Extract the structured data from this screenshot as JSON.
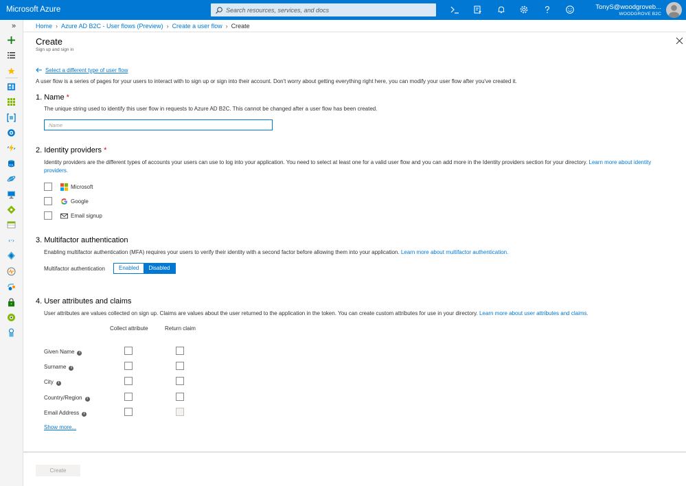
{
  "header": {
    "brand": "Microsoft Azure",
    "search_placeholder": "Search resources, services, and docs",
    "user": "TonyS@woodgroveb...",
    "tenant": "WOODGROVE B2C",
    "icons": [
      "cloud-shell-icon",
      "directory-filter-icon",
      "notifications-icon",
      "settings-icon",
      "help-icon",
      "feedback-icon"
    ]
  },
  "sidebar": {
    "collapse_label": "»",
    "icons": [
      "create-resource-icon",
      "all-services-icon",
      "favorites-icon",
      "dashboard-icon",
      "all-resources-icon",
      "resource-groups-icon",
      "app-services-icon",
      "function-apps-icon",
      "sql-databases-icon",
      "cosmos-db-icon",
      "virtual-machines-icon",
      "load-balancers-icon",
      "storage-accounts-icon",
      "virtual-networks-icon",
      "azure-ad-icon",
      "monitor-icon",
      "advisor-icon",
      "security-center-icon",
      "cost-management-icon",
      "help-support-icon"
    ]
  },
  "breadcrumb": {
    "items": [
      "Home",
      "Azure AD B2C - User flows (Preview)",
      "Create a user flow"
    ],
    "current": "Create"
  },
  "panel": {
    "title": "Create",
    "subtitle": "Sign up and sign in",
    "back_link": "Select a different type of user flow",
    "intro": "A user flow is a series of pages for your users to interact with to sign up or sign into their account. Don't worry about getting everything right here, you can modify your user flow after you've created it."
  },
  "name_section": {
    "heading": "1. Name",
    "required_mark": "*",
    "description": "The unique string used to identify this user flow in requests to Azure AD B2C. This cannot be changed after a user flow has been created.",
    "placeholder": "Name",
    "value": ""
  },
  "idp_section": {
    "heading": "2. Identity providers",
    "required_mark": "*",
    "description": "Identity providers are the different types of accounts your users can use to log into your application. You need to select at least one for a valid user flow and you can add more in the Identity providers section for your directory. ",
    "link": "Learn more about identity providers.",
    "providers": [
      {
        "label": "Microsoft",
        "icon": "microsoft-logo-icon",
        "checked": false
      },
      {
        "label": "Google",
        "icon": "google-logo-icon",
        "checked": false
      },
      {
        "label": "Email signup",
        "icon": "email-icon",
        "checked": false
      }
    ]
  },
  "mfa_section": {
    "heading": "3. Multifactor authentication",
    "description": "Enabling multifactor authentication (MFA) requires your users to verify their identity with a second factor before allowing them into your application. ",
    "link": "Learn more about multifactor authentication.",
    "label": "Multifactor authentication",
    "options": [
      "Enabled",
      "Disabled"
    ],
    "selected": "Disabled"
  },
  "attributes_section": {
    "heading": "4. User attributes and claims",
    "description": "User attributes are values collected on sign up. Claims are values about the user returned to the application in the token. You can create custom attributes for use in your directory. ",
    "link": "Learn more about user attributes and claims.",
    "col_collect": "Collect attribute",
    "col_return": "Return claim",
    "rows": [
      {
        "label": "Given Name",
        "collect": false,
        "return": false
      },
      {
        "label": "Surname",
        "collect": false,
        "return": false
      },
      {
        "label": "City",
        "collect": false,
        "return": false
      },
      {
        "label": "Country/Region",
        "collect": false,
        "return": false
      },
      {
        "label": "Email Address",
        "collect": false,
        "return": false,
        "return_disabled": true
      }
    ],
    "show_more": "Show more..."
  },
  "footer": {
    "create_label": "Create"
  },
  "colors": {
    "azure_blue": "#0078d4",
    "required_red": "#c50f1f"
  }
}
